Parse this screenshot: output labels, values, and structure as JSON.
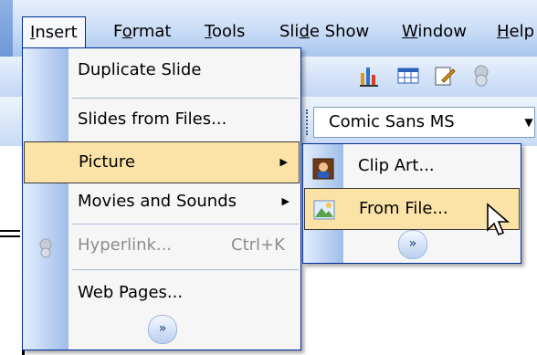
{
  "menubar": {
    "items": [
      {
        "label": "Insert",
        "key": "I"
      },
      {
        "label": "Format",
        "key": "o"
      },
      {
        "label": "Tools",
        "key": "T"
      },
      {
        "label": "Slide Show",
        "key": "d"
      },
      {
        "label": "Window",
        "key": "W"
      },
      {
        "label": "Help",
        "key": "H"
      }
    ]
  },
  "formatting": {
    "font_name": "Comic Sans MS"
  },
  "insert_menu": {
    "items": [
      {
        "label": "Duplicate Slide"
      },
      {
        "label": "Slides from Files..."
      },
      {
        "label": "Picture",
        "has_submenu": true,
        "highlighted": true
      },
      {
        "label": "Movies and Sounds",
        "has_submenu": true
      },
      {
        "label": "Hyperlink...",
        "shortcut": "Ctrl+K",
        "disabled": true
      },
      {
        "label": "Web Pages..."
      }
    ],
    "expand_glyph": "»"
  },
  "picture_submenu": {
    "items": [
      {
        "label": "Clip Art...",
        "icon": "clip-art-icon"
      },
      {
        "label": "From File...",
        "icon": "from-file-icon",
        "highlighted": true
      }
    ],
    "expand_glyph": "»"
  },
  "colors": {
    "highlight": "#fbe3a8",
    "menu_border": "#002d96",
    "gutter": "#9fbdea"
  }
}
